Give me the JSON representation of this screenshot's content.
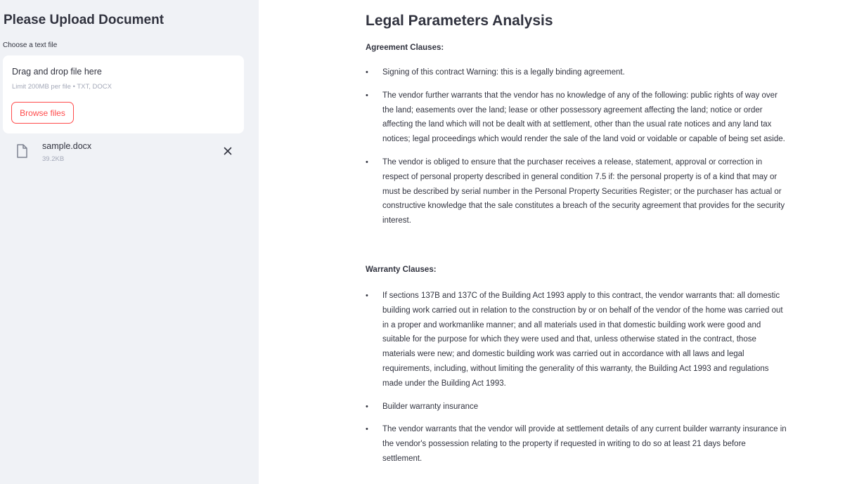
{
  "sidebar": {
    "title": "Please Upload Document",
    "uploader_label": "Choose a text file",
    "dropzone": {
      "main_text": "Drag and drop file here",
      "hint_text": "Limit 200MB per file • TXT, DOCX",
      "browse_label": "Browse files"
    },
    "file": {
      "name": "sample.docx",
      "size": "39.2KB",
      "icon": "file-icon",
      "remove_icon": "close-icon"
    }
  },
  "main": {
    "title": "Legal Parameters Analysis",
    "sections": [
      {
        "heading": "Agreement Clauses:",
        "items": [
          "Signing of this contract Warning: this is a legally binding agreement.",
          "The vendor further warrants that the vendor has no knowledge of any of the following: public rights of way over the land; easements over the land; lease or other possessory agreement affecting the land; notice or order affecting the land which will not be dealt with at settlement, other than the usual rate notices and any land tax notices; legal proceedings which would render the sale of the land void or voidable or capable of being set aside.",
          "The vendor is obliged to ensure that the purchaser receives a release, statement, approval or correction in respect of personal property described in general condition 7.5 if: the personal property is of a kind that may or must be described by serial number in the Personal Property Securities Register; or the purchaser has actual or constructive knowledge that the sale constitutes a breach of the security agreement that provides for the security interest."
        ]
      },
      {
        "heading": "Warranty Clauses:",
        "items": [
          "If sections 137B and 137C of the Building Act 1993 apply to this contract, the vendor warrants that: all domestic building work carried out in relation to the construction by or on behalf of the vendor of the home was carried out in a proper and workmanlike manner; and all materials used in that domestic building work were good and suitable for the purpose for which they were used and that, unless otherwise stated in the contract, those materials were new; and domestic building work was carried out in accordance with all laws and legal requirements, including, without limiting the generality of this warranty, the Building Act 1993 and regulations made under the Building Act 1993.",
          "Builder warranty insurance",
          "The vendor warrants that the vendor will provide at settlement details of any current builder warranty insurance in the vendor's possession relating to the property if requested in writing to do so at least 21 days before settlement."
        ]
      }
    ]
  },
  "colors": {
    "sidebar_bg": "#f0f2f6",
    "accent": "#ff4b4b",
    "text": "#31333f",
    "muted": "#a3a8b8"
  }
}
